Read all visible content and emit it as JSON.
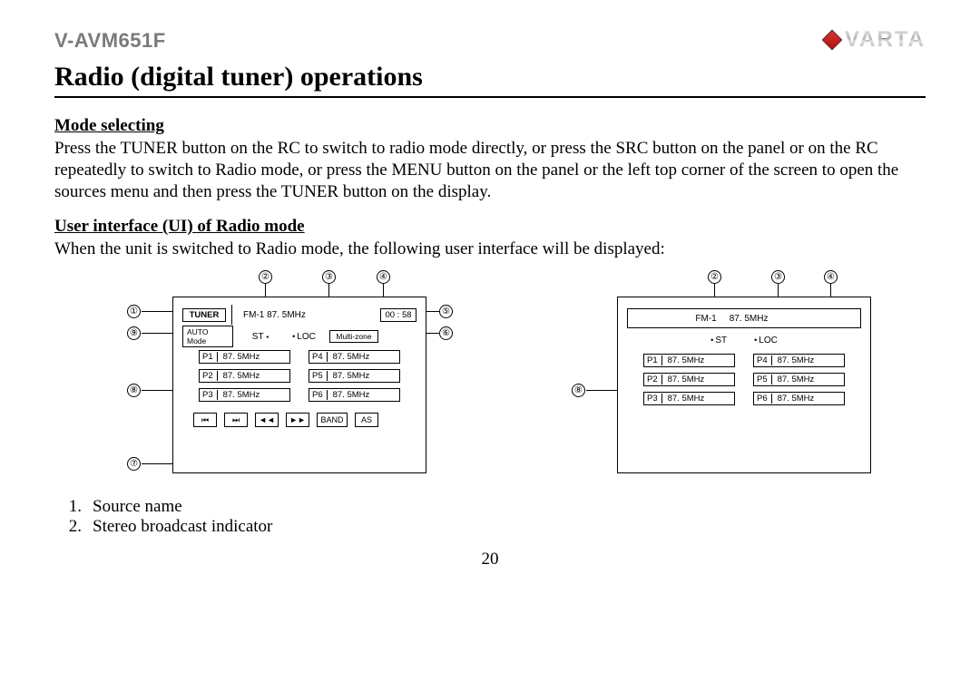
{
  "header": {
    "model": "V-AVM651F",
    "brand": "VARTA"
  },
  "title": "Radio (digital tuner) operations",
  "section1": {
    "heading": "Mode selecting",
    "body": "Press the TUNER button on the RC to switch to radio mode directly, or press the SRC button on the panel or on the RC repeatedly to switch to Radio mode, or press the MENU button on the panel or the left top corner of the screen to open the sources menu and then press the TUNER button on the display."
  },
  "section2": {
    "heading": "User interface (UI) of Radio mode",
    "body": "When the unit is switched to Radio mode, the following user interface will be displayed:"
  },
  "diagA": {
    "tuner": "TUNER",
    "band_freq": "FM-1 87. 5MHz",
    "clock": "00 : 58",
    "auto": "AUTO Mode",
    "st": "ST",
    "loc": "LOC",
    "multi": "Multi-zone",
    "presets": [
      {
        "n": "P1",
        "v": "87. 5MHz"
      },
      {
        "n": "P4",
        "v": "87. 5MHz"
      },
      {
        "n": "P2",
        "v": "87. 5MHz"
      },
      {
        "n": "P5",
        "v": "87. 5MHz"
      },
      {
        "n": "P3",
        "v": "87. 5MHz"
      },
      {
        "n": "P6",
        "v": "87. 5MHz"
      }
    ],
    "buttons": {
      "prev": "⏮",
      "next": "⏭",
      "rew": "◄◄",
      "ff": "►►",
      "band": "BAND",
      "as": "AS"
    },
    "callouts": {
      "c1": "①",
      "c2": "②",
      "c3": "③",
      "c4": "④",
      "c5": "⑤",
      "c6": "⑥",
      "c7": "⑦",
      "c8": "⑧",
      "c9": "⑨"
    }
  },
  "diagB": {
    "band": "FM-1",
    "freq": "87. 5MHz",
    "st": "ST",
    "loc": "LOC",
    "presets": [
      {
        "n": "P1",
        "v": "87. 5MHz"
      },
      {
        "n": "P4",
        "v": "87. 5MHz"
      },
      {
        "n": "P2",
        "v": "87. 5MHz"
      },
      {
        "n": "P5",
        "v": "87. 5MHz"
      },
      {
        "n": "P3",
        "v": "87. 5MHz"
      },
      {
        "n": "P6",
        "v": "87. 5MHz"
      }
    ],
    "callouts": {
      "c2": "②",
      "c3": "③",
      "c4": "④",
      "c8": "⑧"
    }
  },
  "legend": {
    "i1_n": "1.",
    "i1_t": "Source name",
    "i2_n": "2.",
    "i2_t": "Stereo broadcast indicator"
  },
  "page_number": "20"
}
